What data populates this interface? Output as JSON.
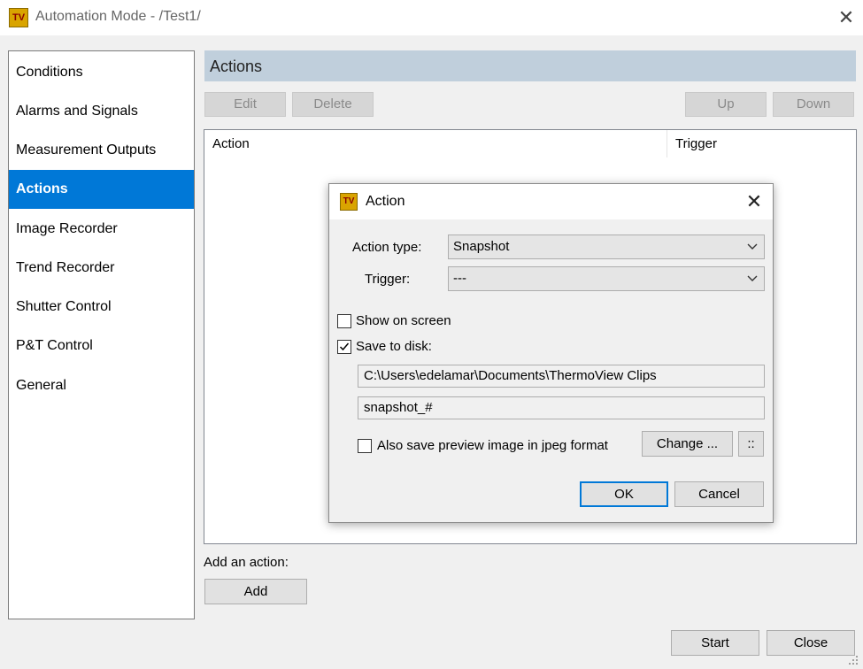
{
  "window": {
    "title": "Automation Mode - /Test1/",
    "app_icon": "TV"
  },
  "sidebar": {
    "items": [
      {
        "label": "Conditions"
      },
      {
        "label": "Alarms and Signals"
      },
      {
        "label": "Measurement Outputs"
      },
      {
        "label": "Actions",
        "selected": true
      },
      {
        "label": "Image Recorder"
      },
      {
        "label": "Trend Recorder"
      },
      {
        "label": "Shutter Control"
      },
      {
        "label": "P&T Control"
      },
      {
        "label": "General"
      }
    ]
  },
  "main": {
    "header": "Actions",
    "toolbar": {
      "edit": "Edit",
      "delete": "Delete",
      "up": "Up",
      "down": "Down"
    },
    "list": {
      "columns": [
        "Action",
        "Trigger"
      ]
    },
    "add_label": "Add an action:",
    "add_button": "Add"
  },
  "footer": {
    "start": "Start",
    "close": "Close"
  },
  "dialog": {
    "title": "Action",
    "icon": "TV",
    "action_type_label": "Action type:",
    "action_type_value": "Snapshot",
    "trigger_label": "Trigger:",
    "trigger_value": "---",
    "show_on_screen_label": "Show on screen",
    "show_on_screen_checked": false,
    "save_to_disk_label": "Save to disk:",
    "save_to_disk_checked": true,
    "path_value": "C:\\Users\\edelamar\\Documents\\ThermoView Clips",
    "filename_value": "snapshot_#",
    "jpeg_label": "Also save preview image in jpeg format",
    "jpeg_checked": false,
    "change_button": "Change ...",
    "more_button": "::",
    "ok_button": "OK",
    "cancel_button": "Cancel"
  },
  "colors": {
    "selected": "#0078d7",
    "header": "#c0cfdc",
    "app_icon_bg": "#d9a400"
  }
}
